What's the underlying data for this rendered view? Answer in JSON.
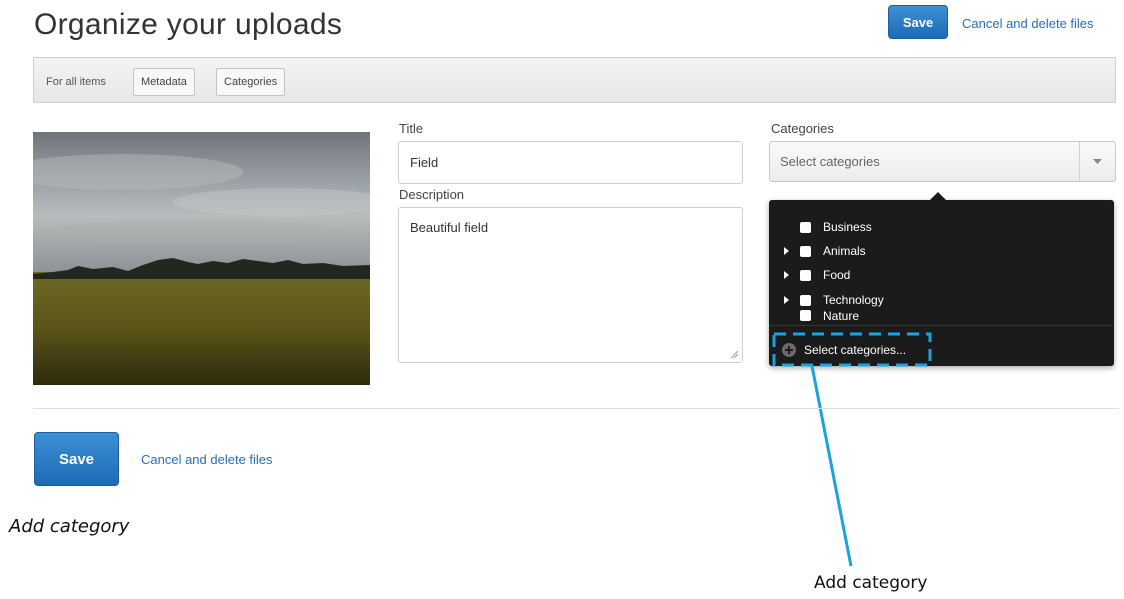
{
  "header": {
    "title": "Organize your uploads",
    "save_label": "Save",
    "cancel_label": "Cancel and delete files"
  },
  "toolbar": {
    "label": "For all items",
    "buttons": [
      "Metadata",
      "Categories"
    ]
  },
  "form": {
    "title_label": "Title",
    "title_value": "Field",
    "description_label": "Description",
    "description_value": "Beautiful field",
    "categories_label": "Categories",
    "categories_placeholder": "Select categories"
  },
  "dropdown": {
    "items": [
      {
        "label": "Business",
        "expandable": false
      },
      {
        "label": "Animals",
        "expandable": true
      },
      {
        "label": "Food",
        "expandable": true
      },
      {
        "label": "Technology",
        "expandable": true
      },
      {
        "label": "Nature",
        "expandable": false
      }
    ],
    "add_label": "Select categories..."
  },
  "footer": {
    "save_label": "Save",
    "cancel_label": "Cancel and delete files"
  },
  "annotations": {
    "note": "Add category",
    "callout": "Add category",
    "callout_color": "#1ba3dd"
  },
  "icons": {
    "dropdown_arrow": "chevron-down-icon",
    "expand": "triangle-right-icon",
    "add": "plus-circle-icon"
  }
}
